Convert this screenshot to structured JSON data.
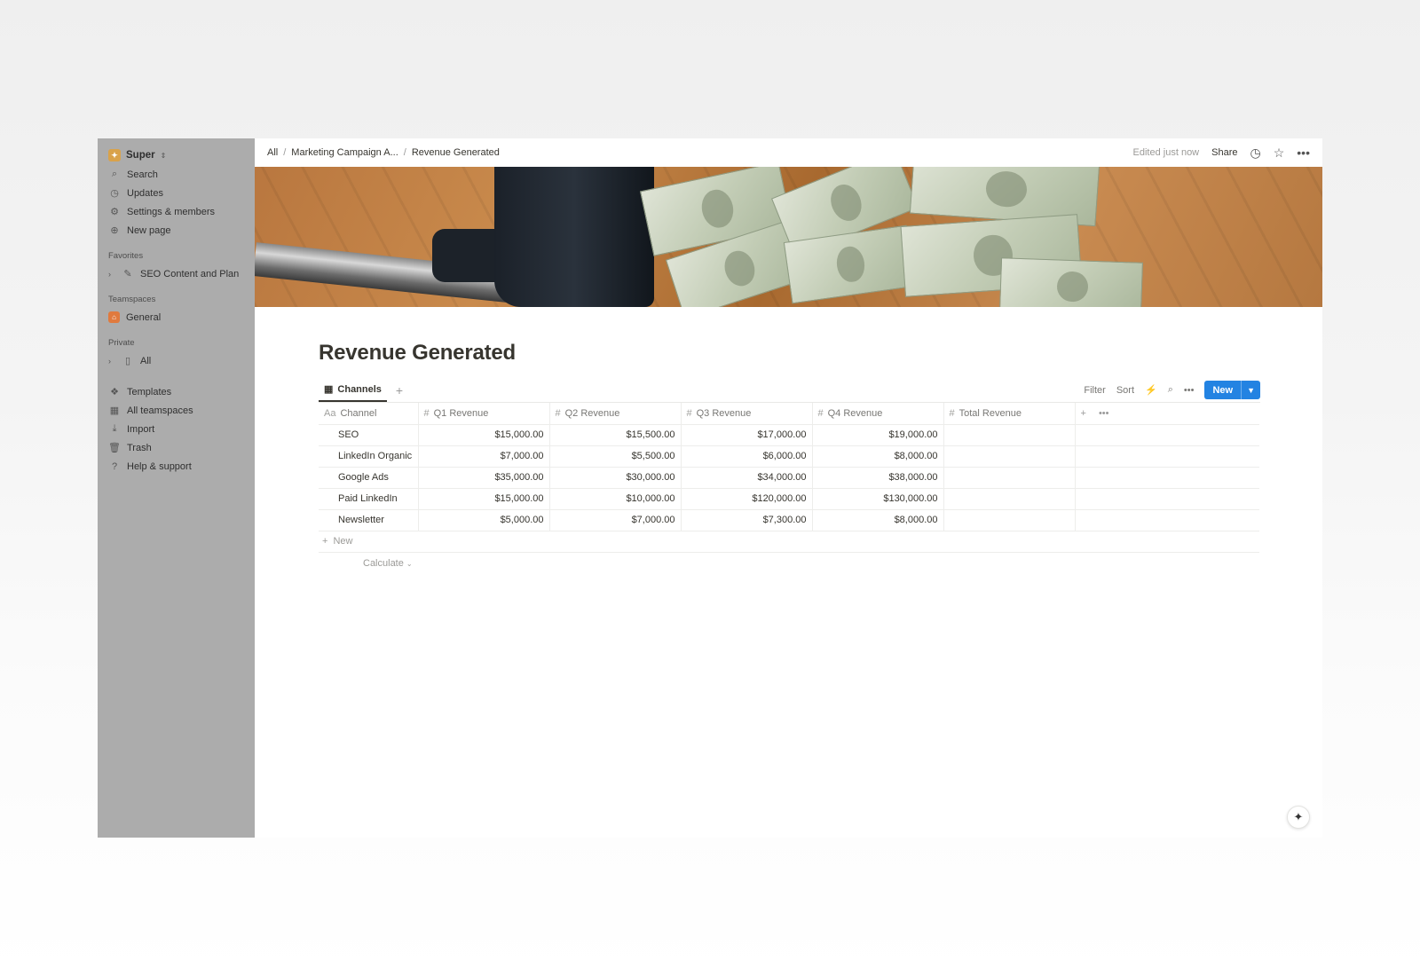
{
  "sidebar": {
    "workspace": "Super",
    "nav": [
      {
        "label": "Search",
        "icon": "search-icon"
      },
      {
        "label": "Updates",
        "icon": "clock-icon"
      },
      {
        "label": "Settings & members",
        "icon": "gear-icon"
      },
      {
        "label": "New page",
        "icon": "plus-circle-icon"
      }
    ],
    "favorites_label": "Favorites",
    "favorites": [
      {
        "label": "SEO Content and Plan",
        "icon": "edit-page-icon"
      }
    ],
    "teamspaces_label": "Teamspaces",
    "teamspaces": [
      {
        "label": "General",
        "icon": "home-icon"
      }
    ],
    "private_label": "Private",
    "private": [
      {
        "label": "All",
        "icon": "page-icon"
      }
    ],
    "bottom": [
      {
        "label": "Templates",
        "icon": "templates-icon"
      },
      {
        "label": "All teamspaces",
        "icon": "building-icon"
      },
      {
        "label": "Import",
        "icon": "download-icon"
      },
      {
        "label": "Trash",
        "icon": "trash-icon"
      },
      {
        "label": "Help & support",
        "icon": "help-icon"
      }
    ]
  },
  "topbar": {
    "breadcrumbs": [
      "All",
      "Marketing Campaign A...",
      "Revenue Generated"
    ],
    "edited": "Edited just now",
    "share": "Share"
  },
  "page": {
    "title": "Revenue Generated"
  },
  "view": {
    "tab": "Channels",
    "filter": "Filter",
    "sort": "Sort",
    "new": "New"
  },
  "table": {
    "columns": [
      {
        "label": "Channel",
        "icon": "Aa"
      },
      {
        "label": "Q1 Revenue",
        "icon": "#"
      },
      {
        "label": "Q2 Revenue",
        "icon": "#"
      },
      {
        "label": "Q3 Revenue",
        "icon": "#"
      },
      {
        "label": "Q4 Revenue",
        "icon": "#"
      },
      {
        "label": "Total Revenue",
        "icon": "#"
      }
    ],
    "rows": [
      {
        "channel": "SEO",
        "q1": "$15,000.00",
        "q2": "$15,500.00",
        "q3": "$17,000.00",
        "q4": "$19,000.00",
        "total": ""
      },
      {
        "channel": "LinkedIn Organic",
        "q1": "$7,000.00",
        "q2": "$5,500.00",
        "q3": "$6,000.00",
        "q4": "$8,000.00",
        "total": ""
      },
      {
        "channel": "Google Ads",
        "q1": "$35,000.00",
        "q2": "$30,000.00",
        "q3": "$34,000.00",
        "q4": "$38,000.00",
        "total": ""
      },
      {
        "channel": "Paid LinkedIn",
        "q1": "$15,000.00",
        "q2": "$10,000.00",
        "q3": "$120,000.00",
        "q4": "$130,000.00",
        "total": ""
      },
      {
        "channel": "Newsletter",
        "q1": "$5,000.00",
        "q2": "$7,000.00",
        "q3": "$7,300.00",
        "q4": "$8,000.00",
        "total": ""
      }
    ],
    "new_row": "New",
    "calculate": "Calculate"
  },
  "colors": {
    "sidebar_bg": "#acacac",
    "accent": "#2383e2",
    "text": "#37352f"
  }
}
